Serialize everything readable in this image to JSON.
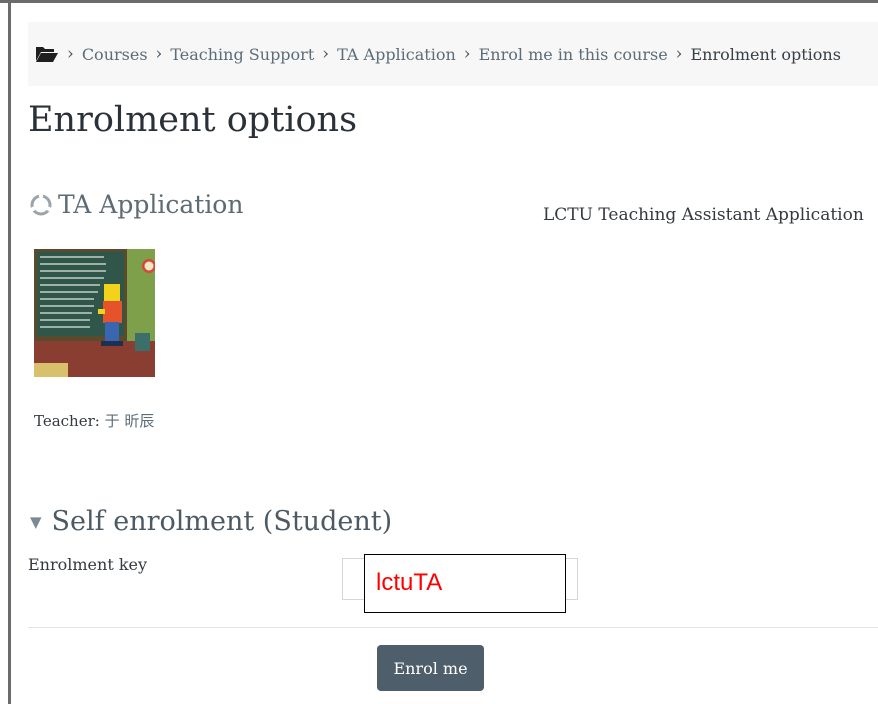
{
  "breadcrumb": {
    "items": [
      "Courses",
      "Teaching Support",
      "TA Application",
      "Enrol me in this course"
    ],
    "current": "Enrolment options",
    "separator": "›"
  },
  "page": {
    "title": "Enrolment options"
  },
  "course": {
    "name": "TA Application",
    "summary": "LCTU Teaching Assistant Application",
    "teacher_label": "Teacher: ",
    "teacher_name": "于 昕辰"
  },
  "enrolment": {
    "section_title": "Self enrolment (Student)",
    "key_label": "Enrolment key",
    "key_value": "lctuTA",
    "button_label": "Enrol me"
  },
  "colors": {
    "button_bg": "#4e5e6a",
    "key_text": "#ff0000",
    "breadcrumb_bg": "#f7f7f7"
  }
}
